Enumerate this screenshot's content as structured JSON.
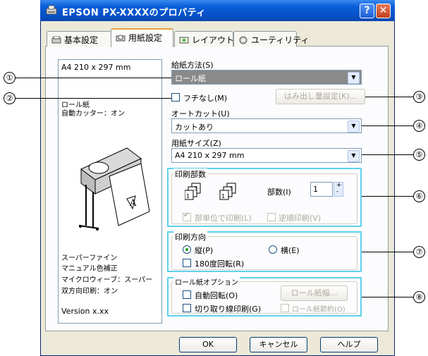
{
  "window": {
    "title": "EPSON PX-XXXXのプロパティ",
    "help_label": "?",
    "close_label": "✕"
  },
  "tabs": [
    {
      "label": "基本設定",
      "icon": "basic-settings-icon"
    },
    {
      "label": "用紙設定",
      "icon": "paper-settings-icon"
    },
    {
      "label": "レイアウト",
      "icon": "layout-icon"
    },
    {
      "label": "ユーティリティ",
      "icon": "utility-icon"
    }
  ],
  "preview": {
    "paper_size": "A4 210 x 297 mm",
    "roll_info": [
      "ロール紙",
      "自動カッター：オン"
    ],
    "settings": [
      "スーパーファイン",
      "マニュアル色補正",
      "マイクロウィーブ：スーパー",
      "双方向印刷：オン"
    ],
    "version": "Version x.xx"
  },
  "paper_source": {
    "label": "給紙方法(S)",
    "value": "ロール紙"
  },
  "borderless": {
    "label": "フチなし(M)",
    "checked": false
  },
  "overflow_button": {
    "label": "はみ出し量設定(K)..."
  },
  "auto_cut": {
    "label": "オートカット(U)",
    "value": "カットあり"
  },
  "paper_size": {
    "label": "用紙サイズ(Z)",
    "value": "A4 210 x 297 mm"
  },
  "copies_group": {
    "title": "印刷部数",
    "copies_label": "部数(I)",
    "copies_value": "1",
    "collate_label": "部単位で印刷(L)",
    "collate_checked": true,
    "reverse_label": "逆順印刷(V)",
    "reverse_checked": false
  },
  "orientation_group": {
    "title": "印刷方向",
    "portrait_label": "縦(P)",
    "landscape_label": "横(E)",
    "selected": "縦(P)",
    "rotate_label": "180度回転(R)",
    "rotate_checked": false
  },
  "roll_options_group": {
    "title": "ロール紙オプション",
    "auto_rotate_label": "自動回転(O)",
    "roll_width_button": "ロール紙幅...",
    "cut_line_label": "切り取り線印刷(G)",
    "paper_saving_label": "ロール紙節約(O)"
  },
  "footer": {
    "ok": "OK",
    "cancel": "キャンセル",
    "help": "ヘルプ"
  },
  "callouts": [
    "①",
    "②",
    "③",
    "④",
    "⑤",
    "⑥",
    "⑦",
    "⑧"
  ],
  "colors": {
    "callout_box": "#5fd1ea",
    "title_bar": "#0653c9",
    "active_tab_accent": "#e6a13f"
  }
}
